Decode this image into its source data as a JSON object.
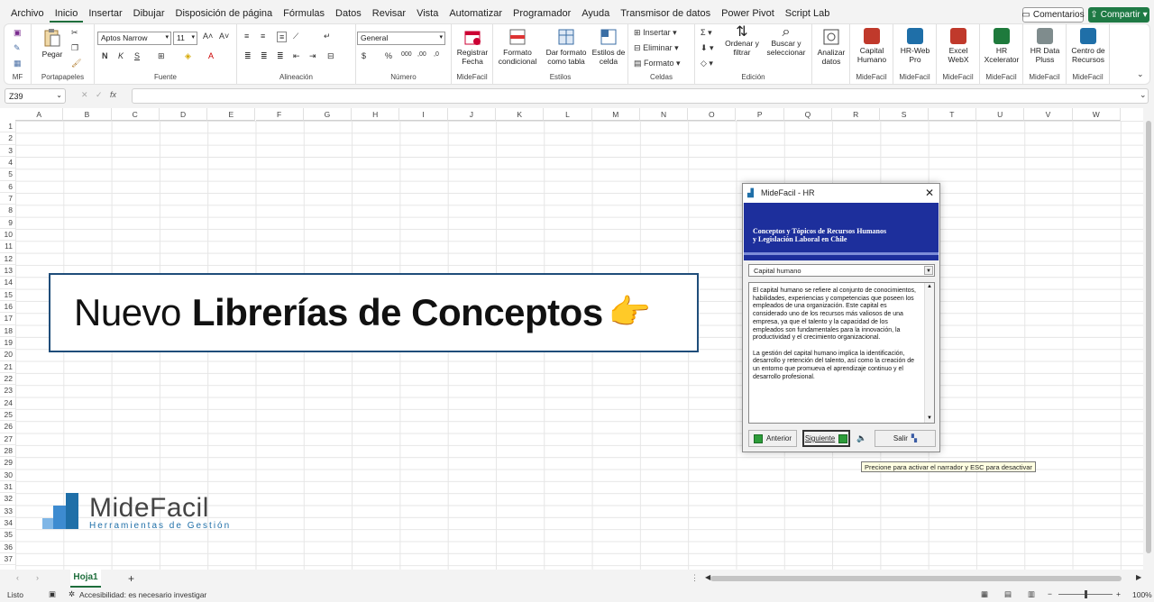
{
  "menu": {
    "tabs": [
      "Archivo",
      "Inicio",
      "Insertar",
      "Dibujar",
      "Disposición de página",
      "Fórmulas",
      "Datos",
      "Revisar",
      "Vista",
      "Automatizar",
      "Programador",
      "Ayuda",
      "Transmisor de datos",
      "Power Pivot",
      "Script Lab"
    ],
    "active_tab": "Inicio",
    "comments": "Comentarios",
    "share": "Compartir"
  },
  "ribbon": {
    "mf": "MF",
    "paste": "Pegar",
    "clipboard": "Portapapeles",
    "font_name": "Aptos Narrow",
    "font_size": "11",
    "font_group": "Fuente",
    "align_group": "Alineación",
    "number_format": "General",
    "number_group": "Número",
    "register_date": "Registrar Fecha",
    "midefacil_label": "MideFacil",
    "cond_format": "Formato condicional",
    "table_format": "Dar formato como tabla",
    "cell_styles": "Estilos de celda",
    "styles_group": "Estilos",
    "insert": "Insertar",
    "delete": "Eliminar",
    "format": "Formato",
    "cells_group": "Celdas",
    "sort_filter": "Ordenar y filtrar",
    "find_select": "Buscar y seleccionar",
    "edit_group": "Edición",
    "analyze": "Analizar datos",
    "addins": [
      {
        "label": "Capital Humano",
        "group": "MideFacil"
      },
      {
        "label": "HR-Web Pro",
        "group": "MideFacil"
      },
      {
        "label": "Excel WebX",
        "group": "MideFacil"
      },
      {
        "label": "HR Xcelerator",
        "group": "MideFacil"
      },
      {
        "label": "HR Data Pluss",
        "group": "MideFacil"
      },
      {
        "label": "Centro de Recursos",
        "group": "MideFacil"
      }
    ]
  },
  "formula_bar": {
    "name_box": "Z39",
    "fx": "fx"
  },
  "columns": [
    "A",
    "B",
    "C",
    "D",
    "E",
    "F",
    "G",
    "H",
    "I",
    "J",
    "K",
    "L",
    "M",
    "N",
    "O",
    "P",
    "Q",
    "R",
    "S",
    "T",
    "U",
    "V",
    "W"
  ],
  "rows": [
    "1",
    "2",
    "3",
    "4",
    "5",
    "6",
    "7",
    "8",
    "9",
    "10",
    "11",
    "12",
    "13",
    "14",
    "15",
    "16",
    "17",
    "18",
    "19",
    "20",
    "21",
    "22",
    "23",
    "24",
    "25",
    "26",
    "27",
    "28",
    "29",
    "30",
    "31",
    "32",
    "33",
    "34",
    "35",
    "36",
    "37"
  ],
  "banner": {
    "light": "Nuevo",
    "bold": "Librerías de Conceptos",
    "emoji": "👉"
  },
  "logo": {
    "name": "MideFacil",
    "tagline": "Herramientas de Gestión"
  },
  "dialog": {
    "title": "MideFacil - HR",
    "header_line1": "Conceptos y Tópicos de Recursos Humanos",
    "header_line2": "y Legislación Laboral en Chile",
    "selected_topic": "Capital humano",
    "paragraph1": "El capital humano se refiere al conjunto de conocimientos, habilidades, experiencias y competencias que poseen los empleados de una organización. Este capital es considerado uno de los recursos más valiosos de una empresa, ya que el talento y la capacidad de los empleados son fundamentales para la innovación, la productividad y el crecimiento organizacional.",
    "paragraph2": "La gestión del capital humano implica la identificación, desarrollo y retención del talento, así como la creación de un entorno que promueva el aprendizaje continuo y el desarrollo profesional.",
    "btn_prev": "Anterior",
    "btn_next": "Siguiente",
    "btn_exit": "Salir"
  },
  "tooltip": "Precione para activar el narrador y ESC para desactivar",
  "sheet_tab": "Hoja1",
  "status": {
    "ready": "Listo",
    "accessibility": "Accesibilidad: es necesario investigar",
    "zoom": "100%"
  }
}
